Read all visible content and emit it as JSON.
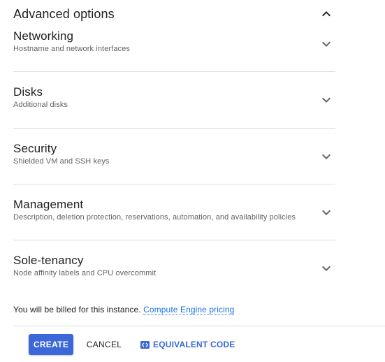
{
  "advanced": {
    "title": "Advanced options",
    "icon": "chevron-up-icon"
  },
  "sections": [
    {
      "title": "Networking",
      "subtitle": "Hostname and network interfaces",
      "icon": "chevron-down-icon"
    },
    {
      "title": "Disks",
      "subtitle": "Additional disks",
      "icon": "chevron-down-icon"
    },
    {
      "title": "Security",
      "subtitle": "Shielded VM and SSH keys",
      "icon": "chevron-down-icon"
    },
    {
      "title": "Management",
      "subtitle": "Description, deletion protection, reservations, automation, and availability policies",
      "icon": "chevron-down-icon"
    },
    {
      "title": "Sole-tenancy",
      "subtitle": "Node affinity labels and CPU overcommit",
      "icon": "chevron-down-icon"
    }
  ],
  "billing": {
    "text": "You will be billed for this instance.",
    "link": "Compute Engine pricing"
  },
  "actions": {
    "create": "CREATE",
    "cancel": "CANCEL",
    "equivalent": "EQUIVALENT CODE",
    "equivalent_icon": "code-icon"
  },
  "colors": {
    "primary": "#3c67d8",
    "link": "#1a73e8",
    "divider": "#dadce0",
    "subtitle": "#5f6368"
  }
}
